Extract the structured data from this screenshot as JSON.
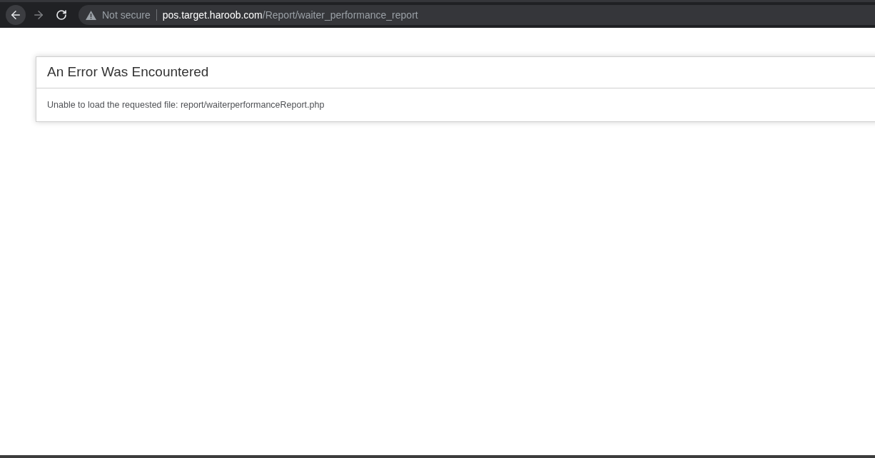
{
  "browser": {
    "back": {
      "disabled": false
    },
    "forward": {
      "disabled": true
    },
    "security": "Not secure",
    "url": {
      "host": "pos.target.haroob.com",
      "path": "/Report/waiter_performance_report"
    }
  },
  "error": {
    "title": "An Error Was Encountered",
    "message": "Unable to load the requested file: report/waiterperformanceReport.php"
  }
}
